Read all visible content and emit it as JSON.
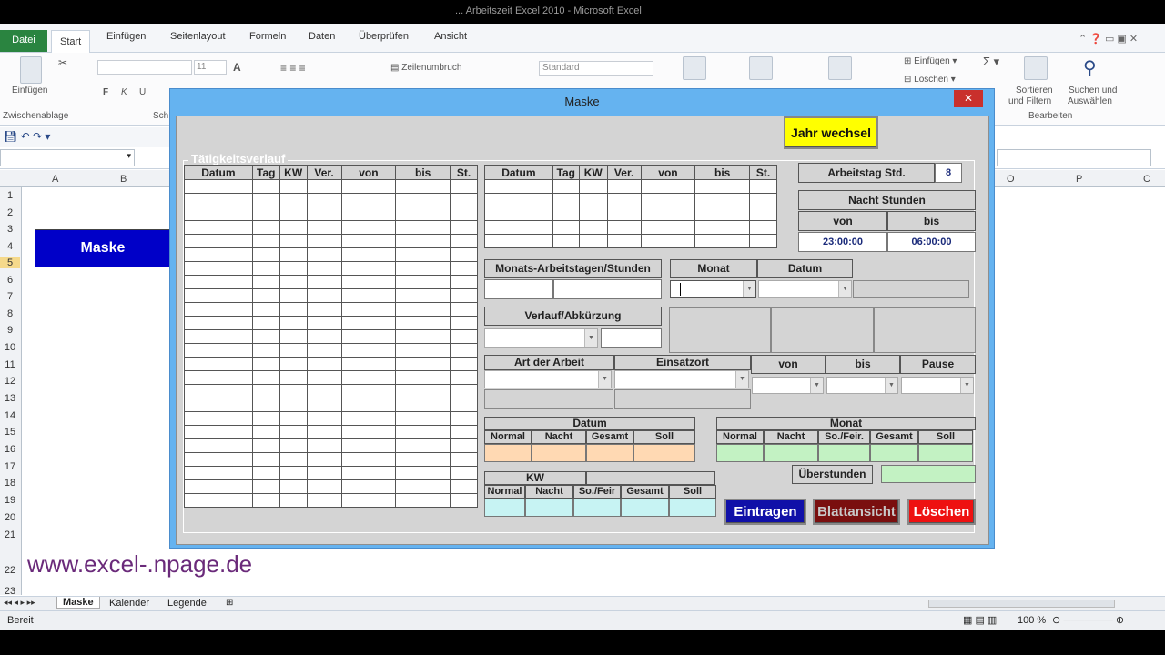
{
  "window": {
    "title": "... Arbeitszeit Excel 2010 - Microsoft Excel"
  },
  "ribbon": {
    "tabs": [
      "Datei",
      "Start",
      "Einfügen",
      "Seitenlayout",
      "Formeln",
      "Daten",
      "Überprüfen",
      "Ansicht"
    ],
    "einfuegen_label": "Einfügen",
    "clipboard_group": "Zwischenablage",
    "font_size": "11",
    "zeilenumbruch": "Zeilenumbruch",
    "number_format": "Standard",
    "cells_insert": "Einfügen",
    "cells_delete": "Löschen",
    "sort_filter_1": "Sortieren",
    "sort_filter_2": "und Filtern",
    "find_1": "Suchen und",
    "find_2": "Auswählen",
    "group_bearbeiten": "Bearbeiten",
    "bold": "F",
    "italic": "K",
    "underline": "U",
    "sch": "Sch"
  },
  "sheet": {
    "columns": [
      "A",
      "B",
      "O",
      "P",
      "C"
    ],
    "rows": [
      "1",
      "2",
      "3",
      "4",
      "5",
      "6",
      "7",
      "8",
      "9",
      "10",
      "11",
      "12",
      "13",
      "14",
      "15",
      "16",
      "17",
      "18",
      "19",
      "20",
      "21",
      "22",
      "23"
    ],
    "button_label": "Maske",
    "website": "www.excel-.npage.de",
    "sheet_tabs": [
      "Maske",
      "Kalender",
      "Legende"
    ],
    "status": "Bereit",
    "zoom": "100 %"
  },
  "dialog": {
    "title": "Maske",
    "close": "✕",
    "btn_jahr": "Jahr wechsel",
    "frame_label": "Tätigkeitsverlauf",
    "list_headers": [
      "Datum",
      "Tag",
      "KW",
      "Ver.",
      "von",
      "bis",
      "St."
    ],
    "arbeitstag_label": "Arbeitstag Std.",
    "arbeitstag_value": "8",
    "nacht_label": "Nacht Stunden",
    "nacht_von": "von",
    "nacht_bis": "bis",
    "nacht_von_val": "23:00:00",
    "nacht_bis_val": "06:00:00",
    "monats_label": "Monats-Arbeitstagen/Stunden",
    "monat_label": "Monat",
    "datum_label": "Datum",
    "verlauf_label": "Verlauf/Abkürzung",
    "art_label": "Art der Arbeit",
    "einsatz_label": "Einsatzort",
    "von_label": "von",
    "bis_label": "bis",
    "pause_label": "Pause",
    "datum_section": "Datum",
    "monat_section": "Monat",
    "sum_headers_datum": [
      "Normal",
      "Nacht",
      "Gesamt",
      "Soll"
    ],
    "sum_headers_monat": [
      "Normal",
      "Nacht",
      "So./Feir.",
      "Gesamt",
      "Soll"
    ],
    "kw_label": "KW",
    "sum_headers_kw": [
      "Normal",
      "Nacht",
      "So./Feir",
      "Gesamt",
      "Soll"
    ],
    "ueberstunden_label": "Überstunden",
    "btn_eintragen": "Eintragen",
    "btn_blattansicht": "Blattansicht",
    "btn_loeschen": "Löschen",
    "colors": {
      "peach": "#ffd9b3",
      "green": "#c3f2c3",
      "cyan": "#c7f3f3",
      "eintragen": "#1010a8",
      "blatt": "#7a0f0f",
      "loeschen": "#ee1111",
      "jahr": "#ffff00"
    }
  }
}
